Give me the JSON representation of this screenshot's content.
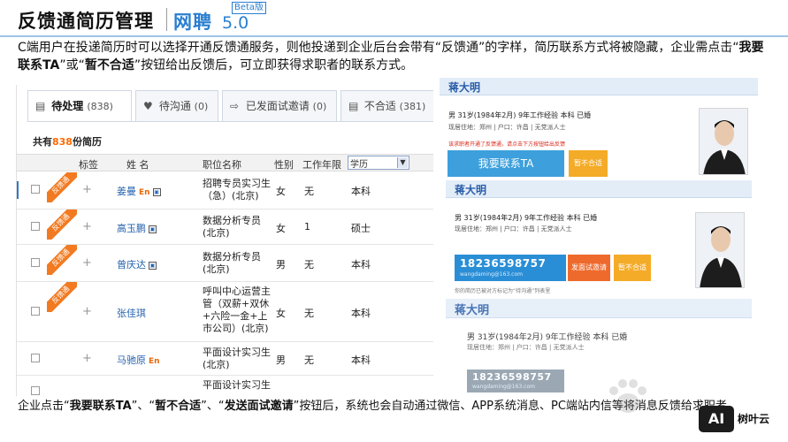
{
  "header": {
    "title": "反馈通简历管理",
    "brand": "网聘",
    "version": "5.0",
    "beta": "Beta版"
  },
  "intro": {
    "part1": "C端用户在投递简历时可以选择开通反馈通服务，则他投递到企业后台会带有“反馈通”的字样，简历联系方式将被隐藏，企业需点击“",
    "btn1": "我要联系TA",
    "part2": "”或“",
    "btn2": "暂不合适",
    "part3": "”按钮给出反馈后，可立即获得求职者的联系方式。"
  },
  "tabs": [
    {
      "icon": "▤",
      "label": "待处理",
      "count": "(838)"
    },
    {
      "icon": "♥",
      "label": "待沟通",
      "count": "(0)"
    },
    {
      "icon": "⇨",
      "label": "已发面试邀请",
      "count": "(0)"
    },
    {
      "icon": "▤",
      "label": "不合适",
      "count": "(381)"
    }
  ],
  "summary": {
    "prefix": "共有",
    "count": "838",
    "suffix": "份简历"
  },
  "columns": {
    "tag": "标签",
    "name": "姓 名",
    "job": "职位名称",
    "gender": "性别",
    "years": "工作年限",
    "edu": "学历"
  },
  "ribbon_label": "反馈通",
  "rows": [
    {
      "name": "姜曼",
      "en": "En",
      "job": "招聘专员实习生（急）(北京)",
      "gender": "女",
      "years": "无",
      "edu": "本科"
    },
    {
      "name": "高玉鹏",
      "en": "",
      "job": "数据分析专员 (北京)",
      "gender": "女",
      "years": "1",
      "edu": "硕士"
    },
    {
      "name": "曾庆达",
      "en": "",
      "job": "数据分析专员 (北京)",
      "gender": "男",
      "years": "无",
      "edu": "本科"
    },
    {
      "name": "张佳琪",
      "en": "",
      "job": "呼叫中心运营主管（双薪+双休+六险一金+上市公司）(北京)",
      "gender": "女",
      "years": "无",
      "edu": "本科"
    },
    {
      "name": "马驰原",
      "en": "En",
      "job": "平面设计实习生(北京)",
      "gender": "男",
      "years": "无",
      "edu": "本科"
    },
    {
      "name": "",
      "en": "",
      "job": "平面设计实习生",
      "gender": "",
      "years": "",
      "edu": ""
    }
  ],
  "resume": {
    "name": "蒋大明",
    "info": "男   31岁(1984年2月)   9年工作经验   本科   已婚",
    "loc": "现居住地：郑州 | 户口：许昌 | 无党派人士",
    "tip_red": "该求职者开通了反馈通，请点击下方按钮给出反馈",
    "btn_contact": "我要联系TA",
    "btn_reject": "暂不合适",
    "phone": "18236598757",
    "email": "wangdaming@163.com",
    "btn_interview": "发面试邀请",
    "tip_gray": "你的简历已被对方标记为“待沟通”列表里",
    "accent_blue": "#3da0dc",
    "accent_orange": "#f4ab27"
  },
  "footer": {
    "part1": "企业点击“",
    "b1": "我要联系TA",
    "part2": "”、“",
    "b2": "暂不合适",
    "part3": "”、“",
    "b3": "发送面试邀请",
    "part4": "”按钮后，系统也会自动通过微信、APP系统消息、PC端站内信等将消息反馈给求职者"
  },
  "watermark": {
    "baidu": "Baidu 经验",
    "aixin": "AI",
    "aixin_text": "树叶云"
  }
}
